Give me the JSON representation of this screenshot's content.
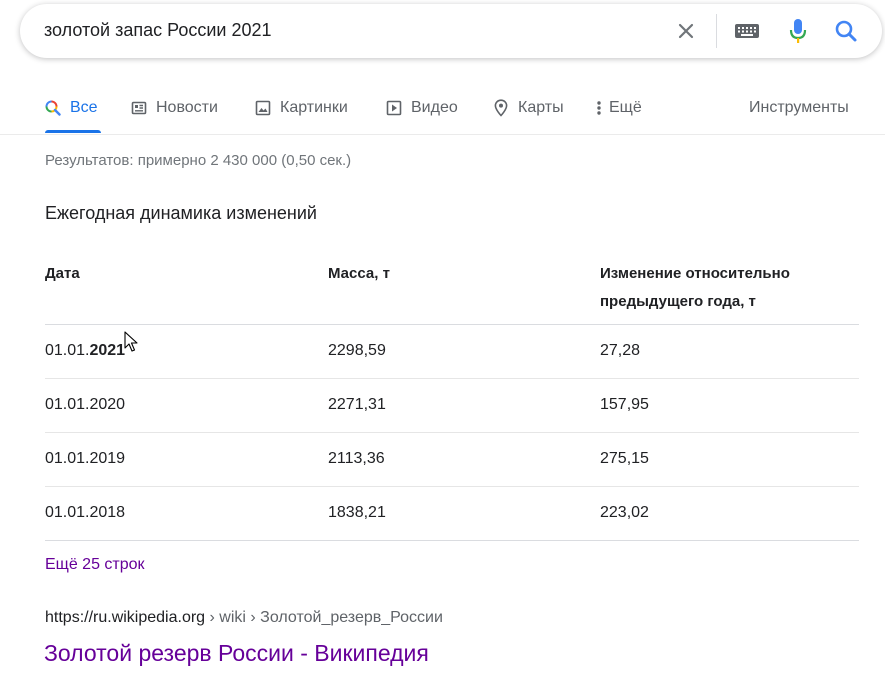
{
  "search": {
    "query": "золотой запас России 2021"
  },
  "tabs": [
    {
      "label": "Все",
      "icon": "search-icon",
      "active": true
    },
    {
      "label": "Новости",
      "icon": "news-icon"
    },
    {
      "label": "Картинки",
      "icon": "image-icon"
    },
    {
      "label": "Видео",
      "icon": "video-icon"
    },
    {
      "label": "Карты",
      "icon": "map-pin-icon"
    },
    {
      "label": "Ещё",
      "icon": "more-vert-icon"
    }
  ],
  "tools_label": "Инструменты",
  "result_stats": "Результатов: примерно 2 430 000 (0,50 сек.)",
  "snippet": {
    "title": "Ежегодная динамика изменений",
    "headers": {
      "date": "Дата",
      "mass": "Масса, т",
      "change_line1": "Изменение относительно",
      "change_line2": "предыдущего года, т"
    },
    "rows": [
      {
        "date_prefix": "01.01.",
        "date_year": "2021",
        "mass": "2298,59",
        "change": "27,28"
      },
      {
        "date": "01.01.2020",
        "mass": "2271,31",
        "change": "157,95"
      },
      {
        "date": "01.01.2019",
        "mass": "2113,36",
        "change": "275,15"
      },
      {
        "date": "01.01.2018",
        "mass": "1838,21",
        "change": "223,02"
      }
    ],
    "more_rows": "Ещё 25 строк"
  },
  "result": {
    "domain": "https://ru.wikipedia.org",
    "path": " › wiki › Золотой_резерв_России",
    "title": "Золотой резерв России - Википедия"
  },
  "colors": {
    "accent_blue": "#1a73e8",
    "visited_link": "#660099",
    "secondary_text": "#5f6368"
  }
}
